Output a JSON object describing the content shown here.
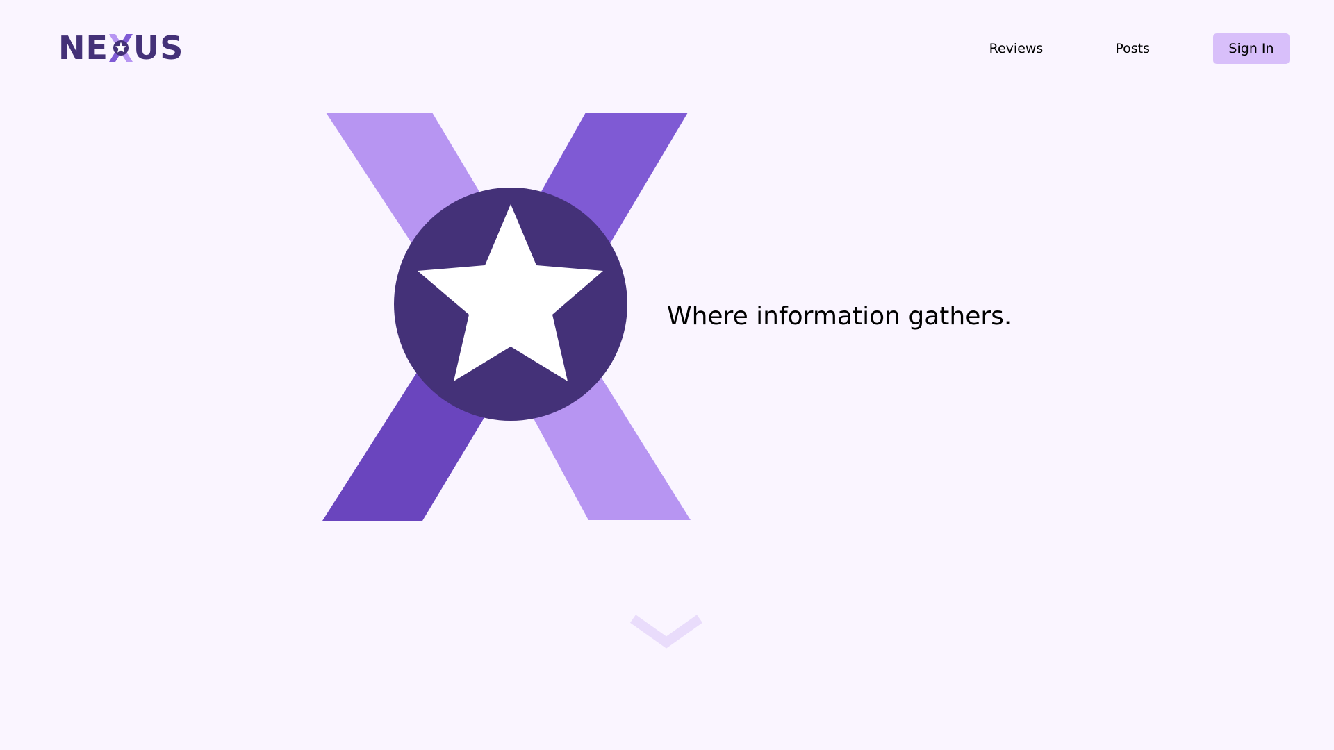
{
  "brand": {
    "name_left": "NE",
    "name_right": "US",
    "logo_mark_icon": "x-star-logo-icon",
    "colors": {
      "dark_purple": "#443178",
      "medium_purple": "#7f5ad4",
      "deep_purple": "#6a45be",
      "light_purple": "#b795f2",
      "button_bg": "#d8bffa",
      "page_bg": "#faf5ff",
      "chevron": "#e9dcfb"
    }
  },
  "nav": {
    "reviews_label": "Reviews",
    "posts_label": "Posts",
    "signin_label": "Sign In"
  },
  "hero": {
    "emblem_icon": "x-star-emblem-icon",
    "tagline": "Where information gathers."
  },
  "scroll": {
    "icon": "chevron-down-icon"
  }
}
